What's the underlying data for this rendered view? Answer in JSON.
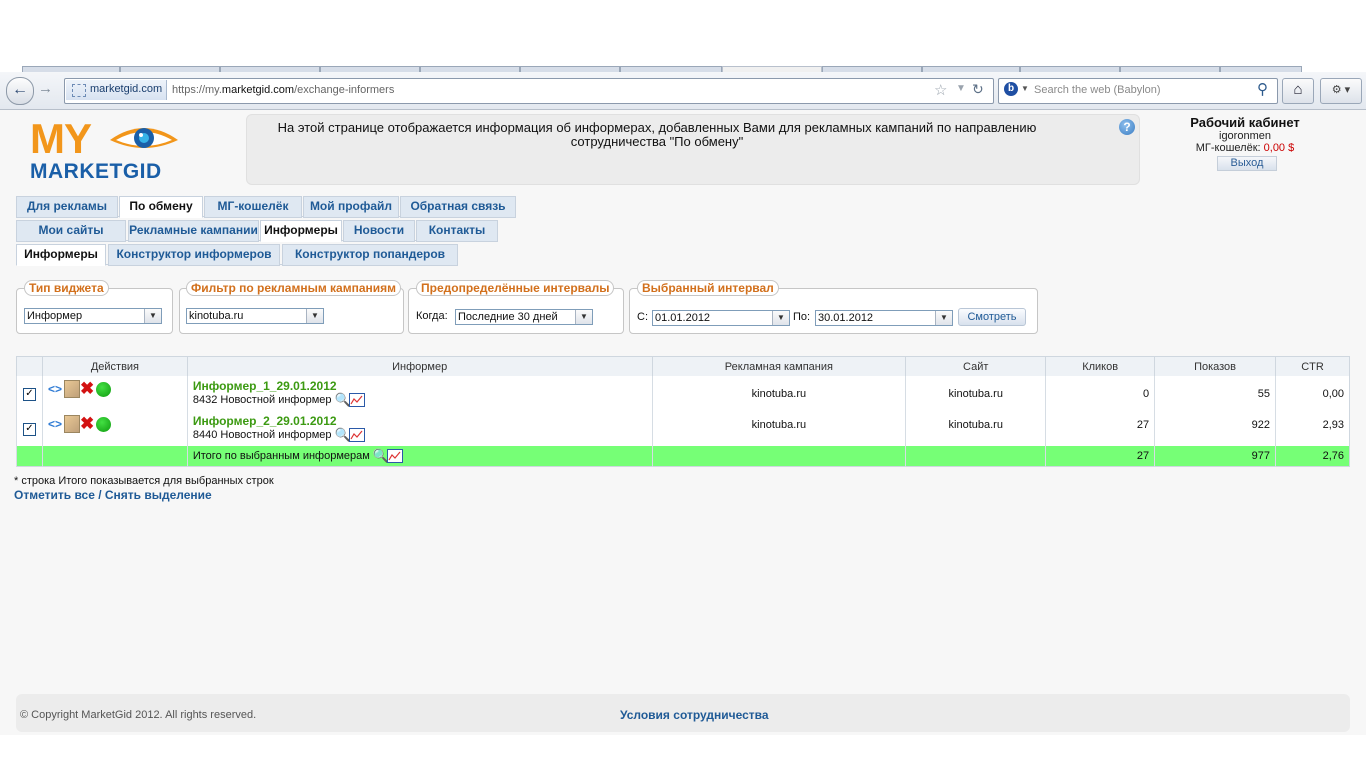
{
  "browser": {
    "site_identity": "marketgid.com",
    "url_prefix": "https://my.",
    "url_domain": "marketgid.com",
    "url_path": "/exchange-informers",
    "search_placeholder": "Search the web (Babylon)"
  },
  "header": {
    "logo_top": "MY",
    "logo_bottom": "MARKETGID",
    "info_text": "На этой странице отображается информация об информерах, добавленных Вами для рекламных кампаний по направлению сотрудничества \"По обмену\"",
    "help": "?",
    "cabinet_title": "Рабочий кабинет",
    "username": "igoronmen",
    "wallet_label": "МГ-кошелёк:",
    "wallet_value": "0,00 $",
    "logout": "Выход"
  },
  "tabs_main": [
    "Для рекламы",
    "По обмену",
    "МГ-кошелёк",
    "Мой профайл",
    "Обратная связь"
  ],
  "tabs_sub": [
    "Мои сайты",
    "Рекламные кампании",
    "Информеры",
    "Новости",
    "Контакты"
  ],
  "tabs_sub2": [
    "Информеры",
    "Конструктор информеров",
    "Конструктор попандеров"
  ],
  "filters": {
    "widget_type_legend": "Тип виджета",
    "widget_type_value": "Информер",
    "campaign_legend": "Фильтр по рекламным кампаниям",
    "campaign_value": "kinotuba.ru",
    "predef_legend": "Предопределённые интервалы",
    "predef_label": "Когда:",
    "predef_value": "Последние 30 дней",
    "interval_legend": "Выбранный интервал",
    "from_label": "С:",
    "from_value": "01.01.2012",
    "to_label": "По:",
    "to_value": "30.01.2012",
    "view_button": "Смотреть"
  },
  "table": {
    "headers": [
      "Действия",
      "Информер",
      "Рекламная кампания",
      "Сайт",
      "Кликов",
      "Показов",
      "CTR"
    ],
    "rows": [
      {
        "checked": "✓",
        "name": "Информер_1_29.01.2012",
        "sub": "8432 Новостной информер",
        "campaign": "kinotuba.ru",
        "site": "kinotuba.ru",
        "clicks": "0",
        "shows": "55",
        "ctr": "0,00"
      },
      {
        "checked": "✓",
        "name": "Информер_2_29.01.2012",
        "sub": "8440 Новостной информер",
        "campaign": "kinotuba.ru",
        "site": "kinotuba.ru",
        "clicks": "27",
        "shows": "922",
        "ctr": "2,93"
      }
    ],
    "total": {
      "label": "Итого по выбранным информерам",
      "clicks": "27",
      "shows": "977",
      "ctr": "2,76"
    }
  },
  "note": "* строка Итого показывается для выбранных строк",
  "select_all": "Отметить все / Снять выделение",
  "footer": {
    "copyright": "© Copyright MarketGid 2012. All rights reserved.",
    "terms": "Условия сотрудничества"
  },
  "colors": {
    "accent": "#1f5a96",
    "total_row": "#76ff76",
    "legend": "#d2701c",
    "name_green": "#3c9a12"
  }
}
